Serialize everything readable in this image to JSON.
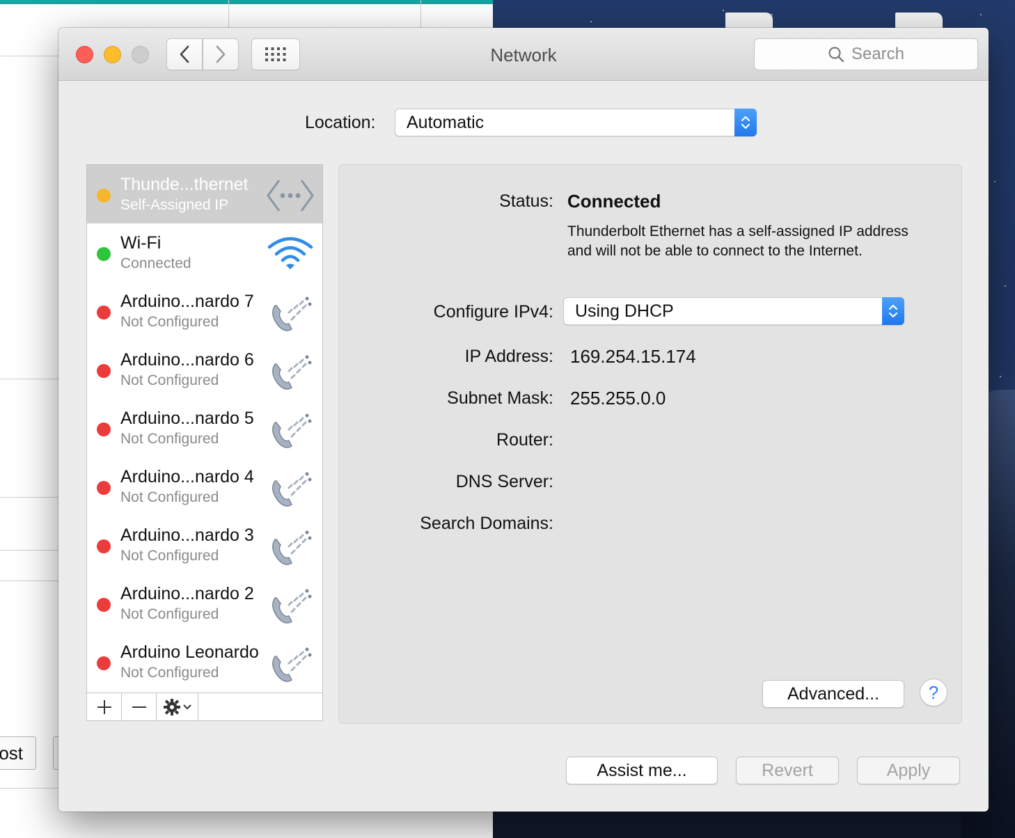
{
  "window": {
    "title": "Network",
    "search_placeholder": "Search"
  },
  "location": {
    "label": "Location:",
    "value": "Automatic"
  },
  "services": [
    {
      "name": "Thunde...thernet",
      "status": "Self-Assigned IP",
      "dot_color": "#f6b62b",
      "icon": "ethernet-icon",
      "selected": true
    },
    {
      "name": "Wi-Fi",
      "status": "Connected",
      "dot_color": "#2ec43c",
      "icon": "wifi-icon",
      "selected": false
    },
    {
      "name": "Arduino...nardo 7",
      "status": "Not Configured",
      "dot_color": "#ec3b3b",
      "icon": "modem-phone-icon",
      "selected": false
    },
    {
      "name": "Arduino...nardo 6",
      "status": "Not Configured",
      "dot_color": "#ec3b3b",
      "icon": "modem-phone-icon",
      "selected": false
    },
    {
      "name": "Arduino...nardo 5",
      "status": "Not Configured",
      "dot_color": "#ec3b3b",
      "icon": "modem-phone-icon",
      "selected": false
    },
    {
      "name": "Arduino...nardo 4",
      "status": "Not Configured",
      "dot_color": "#ec3b3b",
      "icon": "modem-phone-icon",
      "selected": false
    },
    {
      "name": "Arduino...nardo 3",
      "status": "Not Configured",
      "dot_color": "#ec3b3b",
      "icon": "modem-phone-icon",
      "selected": false
    },
    {
      "name": "Arduino...nardo 2",
      "status": "Not Configured",
      "dot_color": "#ec3b3b",
      "icon": "modem-phone-icon",
      "selected": false
    },
    {
      "name": "Arduino Leonardo",
      "status": "Not Configured",
      "dot_color": "#ec3b3b",
      "icon": "modem-phone-icon",
      "selected": false
    }
  ],
  "detail": {
    "status_label": "Status:",
    "status_value": "Connected",
    "status_description": "Thunderbolt Ethernet has a self-assigned IP address and will not be able to connect to the Internet.",
    "configure_label": "Configure IPv4:",
    "configure_value": "Using DHCP",
    "ip_label": "IP Address:",
    "ip_value": "169.254.15.174",
    "subnet_label": "Subnet Mask:",
    "subnet_value": "255.255.0.0",
    "router_label": "Router:",
    "router_value": "",
    "dns_label": "DNS Server:",
    "dns_value": "",
    "domains_label": "Search Domains:",
    "domains_value": "",
    "advanced_label": "Advanced...",
    "help_label": "?"
  },
  "footer": {
    "assist_label": "Assist me...",
    "revert_label": "Revert",
    "apply_label": "Apply"
  },
  "background": {
    "post_button_label": "Post"
  },
  "colors": {
    "accent_blue": "#2f7ef2",
    "status_yellow": "#f6b62b",
    "status_green": "#2ec43c",
    "status_red": "#ec3b3b"
  }
}
